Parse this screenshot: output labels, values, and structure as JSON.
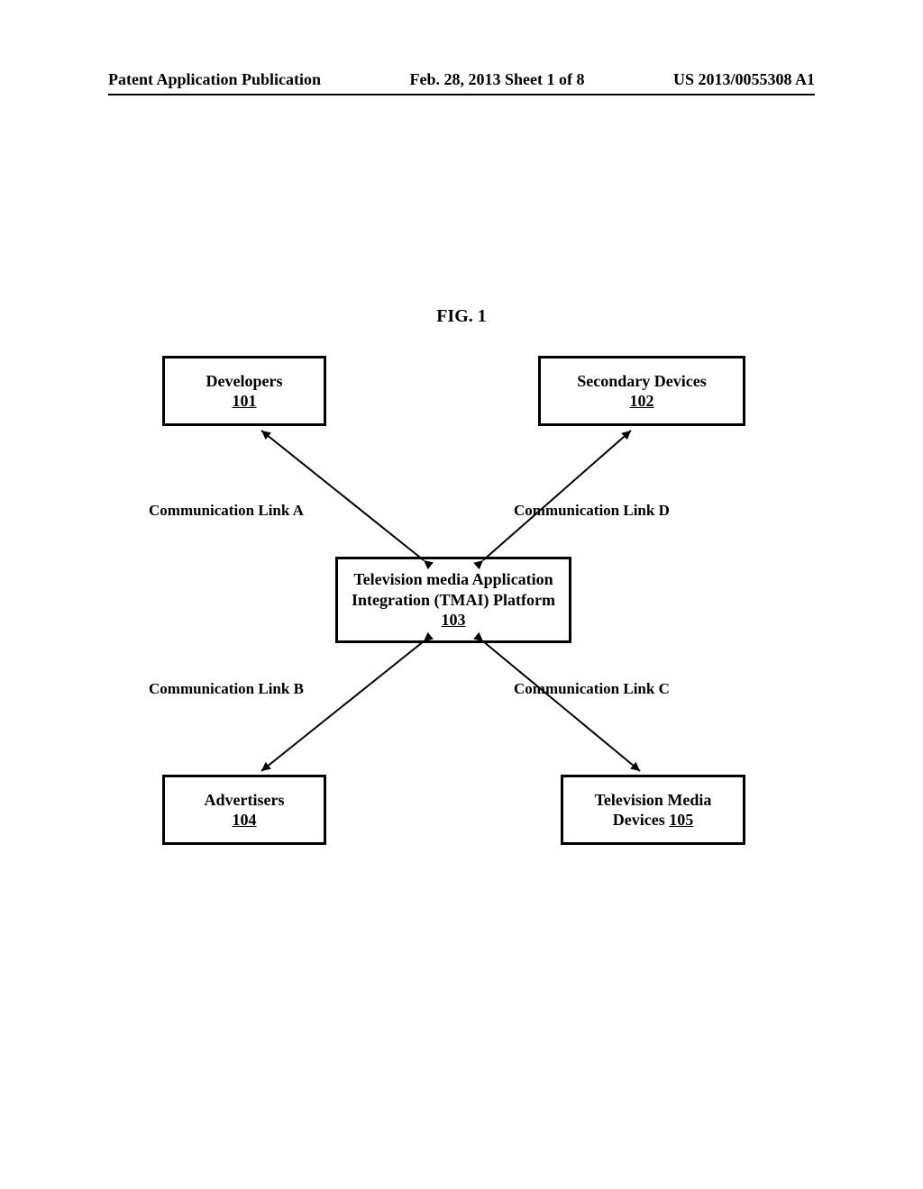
{
  "header": {
    "left": "Patent Application Publication",
    "center": "Feb. 28, 2013  Sheet 1 of 8",
    "right": "US 2013/0055308 A1"
  },
  "figure_title": "FIG. 1",
  "boxes": {
    "developers": {
      "label": "Developers",
      "ref": "101"
    },
    "secondary": {
      "label": "Secondary Devices",
      "ref": "102"
    },
    "platform": {
      "line1": "Television media Application",
      "line2": "Integration (TMAI) Platform",
      "ref": "103"
    },
    "advertisers": {
      "label": "Advertisers",
      "ref": "104"
    },
    "tv_media": {
      "line1": "Television Media",
      "line2": "Devices ",
      "ref": "105"
    }
  },
  "links": {
    "a": "Communication Link A",
    "b": "Communication Link B",
    "c": "Communication Link C",
    "d": "Communication Link D"
  }
}
